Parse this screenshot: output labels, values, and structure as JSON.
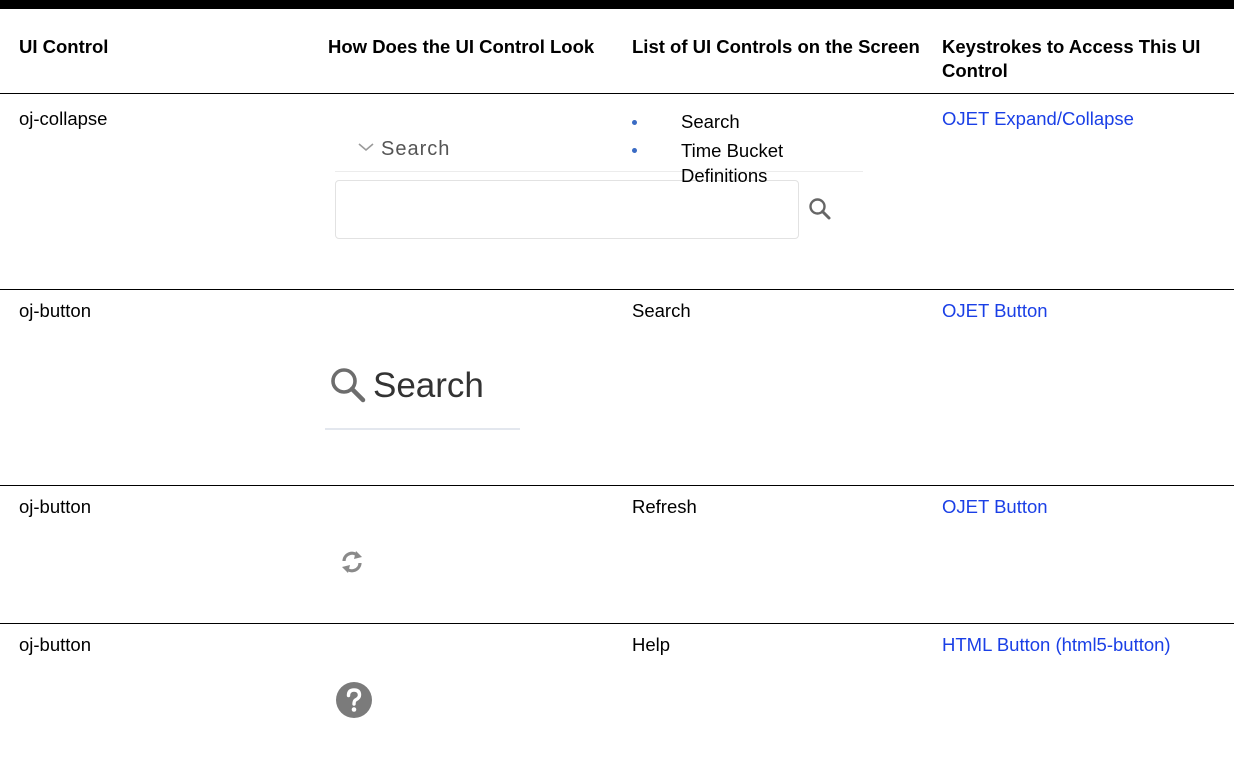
{
  "headers": [
    "UI Control",
    "How Does the UI Control Look",
    "List of UI Controls on the Screen",
    "Keystrokes to Access This UI Control"
  ],
  "rows": [
    {
      "control": "oj-collapse",
      "preview_label": "Search",
      "controls_list": [
        "Search",
        "Time Bucket Definitions"
      ],
      "keystrokes": "OJET Expand/Collapse"
    },
    {
      "control": "oj-button",
      "preview_label": "Search",
      "controls_list": [
        "Search"
      ],
      "keystrokes": "OJET Button"
    },
    {
      "control": "oj-button",
      "controls_list": [
        "Refresh"
      ],
      "keystrokes": "OJET Button"
    },
    {
      "control": "oj-button",
      "controls_list": [
        "Help"
      ],
      "keystrokes": "HTML Button (html5-button)"
    }
  ],
  "icons": [
    "chevron-down-icon",
    "search-icon",
    "refresh-icon",
    "help-icon"
  ],
  "colors": {
    "link": "#1a3fe6",
    "bullet": "#3a6bc4",
    "help_icon": "#7b7b7b"
  }
}
